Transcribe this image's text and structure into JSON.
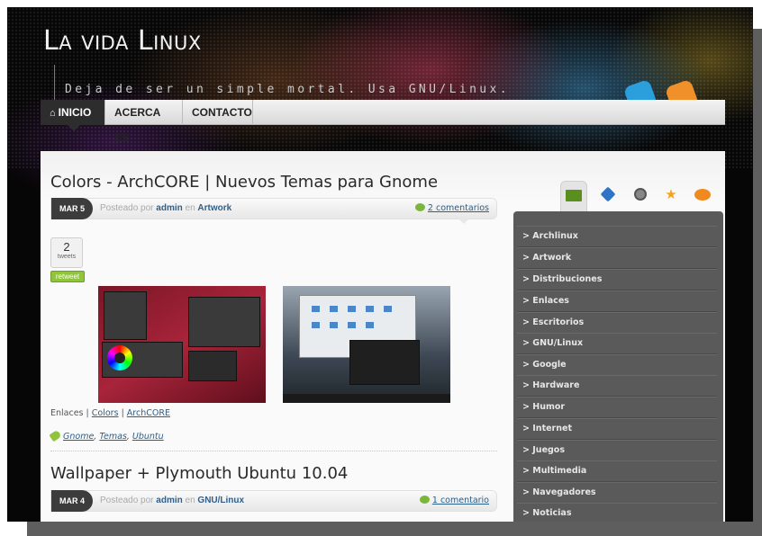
{
  "site": {
    "title": "La vida Linux",
    "tagline": "Deja de ser un simple mortal. Usa GNU/Linux."
  },
  "nav": {
    "items": [
      {
        "label": "INICIO",
        "active": true,
        "icon": "home-icon"
      },
      {
        "label": "ACERCA DE",
        "active": false
      },
      {
        "label": "CONTACTO",
        "active": false
      }
    ]
  },
  "posts": [
    {
      "title": "Colors - ArchCORE | Nuevos Temas para Gnome",
      "date": "MAR 5",
      "posted_by_prefix": "Posteado por",
      "author": "admin",
      "in_word": "en",
      "category": "Artwork",
      "comments": "2 comentarios",
      "tweets_count": "2",
      "tweets_label": "tweets",
      "retweet": "retweet",
      "links_prefix": "Enlaces |",
      "link_1": "Colors",
      "link_sep": "|",
      "link_2": "ArchCORE",
      "tags": [
        "Gnome",
        "Temas",
        "Ubuntu"
      ]
    },
    {
      "title": "Wallpaper + Plymouth Ubuntu 10.04",
      "date": "MAR 4",
      "posted_by_prefix": "Posteado por",
      "author": "admin",
      "in_word": "en",
      "category": "GNU/Linux",
      "comments": "1 comentario"
    }
  ],
  "sidebar": {
    "tabs": [
      "folder-icon",
      "tag-icon",
      "clock-icon",
      "star-icon",
      "chat-icon"
    ],
    "categories": [
      "> Archlinux",
      "> Artwork",
      "> Distribuciones",
      "> Enlaces",
      "> Escritorios",
      "> GNU/Linux",
      "> Google",
      "> Hardware",
      "> Humor",
      "> Internet",
      "> Juegos",
      "> Multimedia",
      "> Navegadores",
      "> Noticias"
    ]
  },
  "colors": {
    "background": "#060606",
    "nav_active": "#2d2d2d",
    "sidebar_panel": "#5a5a5a",
    "link": "#2a5e8c",
    "retweet": "#8fc43c"
  }
}
